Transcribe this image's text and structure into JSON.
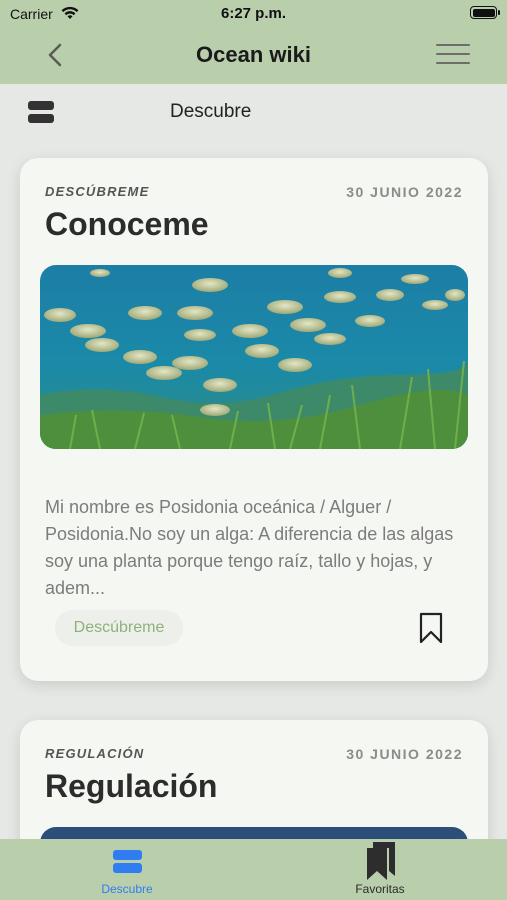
{
  "status_bar": {
    "carrier": "Carrier",
    "time": "6:27 p.m."
  },
  "nav": {
    "title": "Ocean wiki"
  },
  "subheader": {
    "label": "Descubre"
  },
  "cards": [
    {
      "category": "DESCÚBREME",
      "date": "30 JUNIO 2022",
      "title": "Conoceme",
      "excerpt": "Mi nombre es Posidonia oceánica / Alguer / Posidonia.No soy un alga: A diferencia de las algas soy una planta porque tengo raíz, tallo y hojas, y adem...",
      "chip": "Descúbreme"
    },
    {
      "category": "REGULACIÓN",
      "date": "30 JUNIO 2022",
      "title": "Regulación"
    }
  ],
  "tabbar": {
    "tabs": [
      {
        "label": "Descubre",
        "icon": "stack-icon",
        "active": true,
        "color": "#2f7df0"
      },
      {
        "label": "Favoritas",
        "icon": "bookmarks-icon",
        "active": false,
        "color": "#2a2a2a"
      }
    ]
  },
  "colors": {
    "header_green": "#b9cfac",
    "background": "#e6e8e5",
    "card": "#f5f7f3",
    "chip_text": "#8fb07c",
    "active_tab": "#2f7df0"
  }
}
